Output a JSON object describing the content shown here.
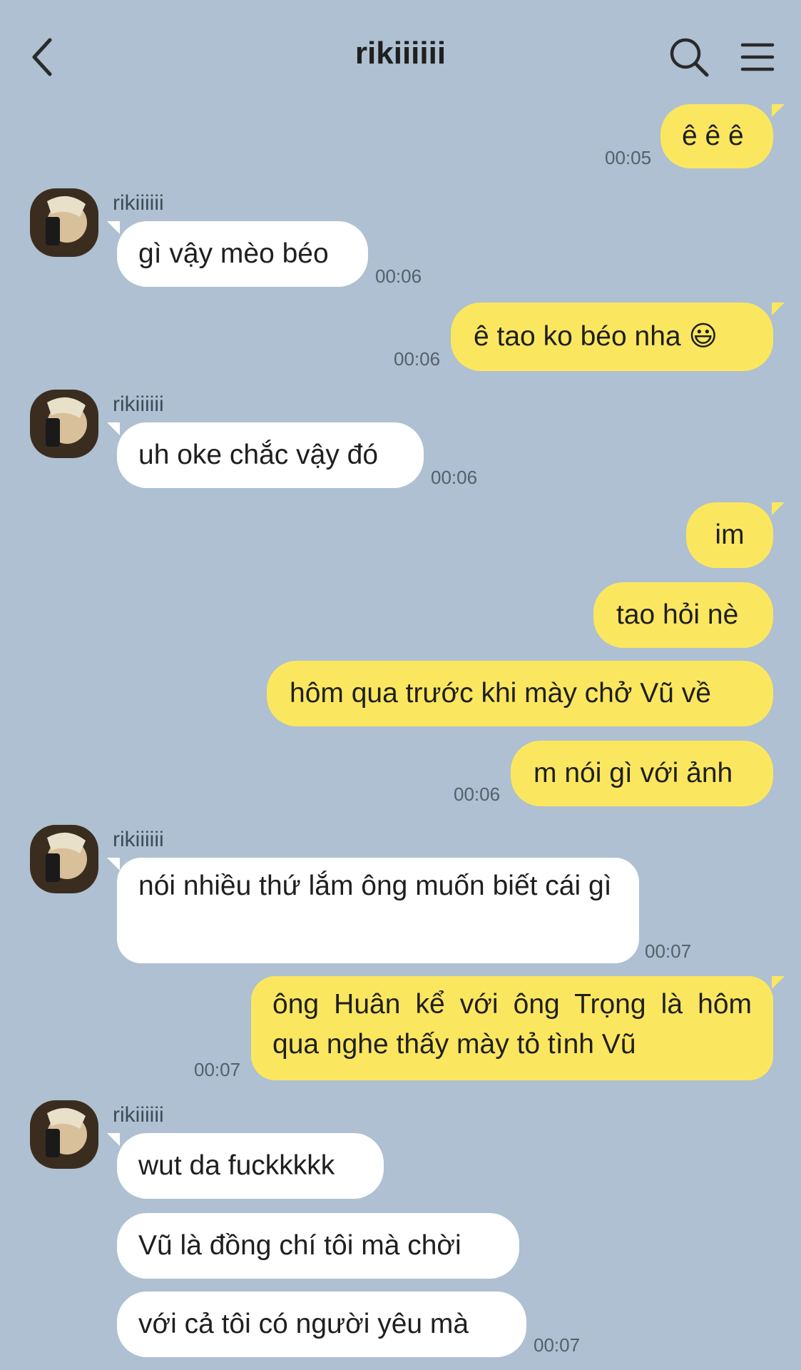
{
  "header": {
    "title": "rikiiiiii",
    "back_icon": "chevron-left-icon",
    "search_icon": "search-icon",
    "menu_icon": "hamburger-menu-icon"
  },
  "colors": {
    "background": "#aec0d1",
    "my_bubble": "#fbe75f",
    "their_bubble": "#ffffff"
  },
  "messages": [
    {
      "from": "me",
      "text": "ê ê ê",
      "time": "00:05"
    },
    {
      "from": "them",
      "sender": "rikiiiiii",
      "text": "gì vậy mèo béo",
      "time": "00:06"
    },
    {
      "from": "me",
      "text": "ê tao ko béo nha 😃",
      "time": "00:06"
    },
    {
      "from": "them",
      "sender": "rikiiiiii",
      "text": "uh oke chắc vậy đó",
      "time": "00:06"
    },
    {
      "from": "me",
      "text": "im"
    },
    {
      "from": "me",
      "text": "tao hỏi nè"
    },
    {
      "from": "me",
      "text": "hôm qua trước khi mày chở Vũ về"
    },
    {
      "from": "me",
      "text": "m nói gì với ảnh",
      "time": "00:06"
    },
    {
      "from": "them",
      "sender": "rikiiiiii",
      "text": "nói nhiều thứ lắm ông muốn biết cái gì",
      "time": "00:07"
    },
    {
      "from": "me",
      "text": "ông Huân kể với ông Trọng là hôm qua nghe thấy mày tỏ tình Vũ",
      "time": "00:07"
    },
    {
      "from": "them",
      "sender": "rikiiiiii",
      "text": "wut da fuckkkkk"
    },
    {
      "from": "them",
      "text": "Vũ là đồng chí tôi mà chời"
    },
    {
      "from": "them",
      "text": "với cả tôi có người yêu mà",
      "time": "00:07"
    }
  ]
}
